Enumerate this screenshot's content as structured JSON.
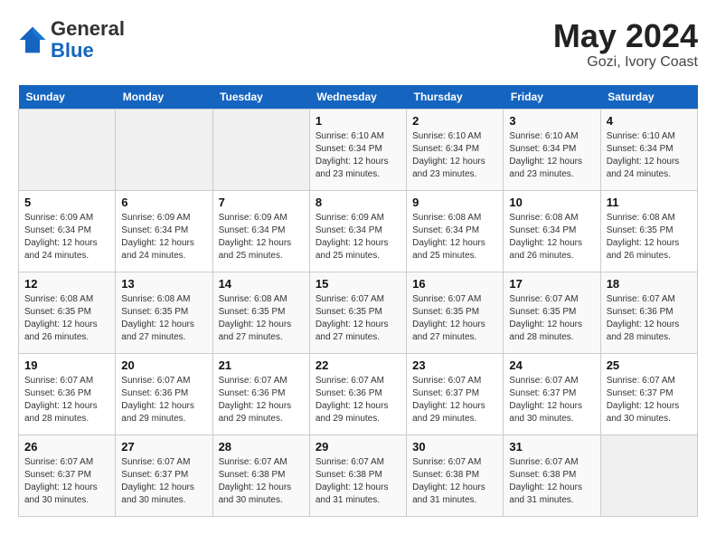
{
  "header": {
    "logo_general": "General",
    "logo_blue": "Blue",
    "month_year": "May 2024",
    "location": "Gozi, Ivory Coast"
  },
  "weekdays": [
    "Sunday",
    "Monday",
    "Tuesday",
    "Wednesday",
    "Thursday",
    "Friday",
    "Saturday"
  ],
  "weeks": [
    [
      {
        "day": "",
        "info": ""
      },
      {
        "day": "",
        "info": ""
      },
      {
        "day": "",
        "info": ""
      },
      {
        "day": "1",
        "info": "Sunrise: 6:10 AM\nSunset: 6:34 PM\nDaylight: 12 hours\nand 23 minutes."
      },
      {
        "day": "2",
        "info": "Sunrise: 6:10 AM\nSunset: 6:34 PM\nDaylight: 12 hours\nand 23 minutes."
      },
      {
        "day": "3",
        "info": "Sunrise: 6:10 AM\nSunset: 6:34 PM\nDaylight: 12 hours\nand 23 minutes."
      },
      {
        "day": "4",
        "info": "Sunrise: 6:10 AM\nSunset: 6:34 PM\nDaylight: 12 hours\nand 24 minutes."
      }
    ],
    [
      {
        "day": "5",
        "info": "Sunrise: 6:09 AM\nSunset: 6:34 PM\nDaylight: 12 hours\nand 24 minutes."
      },
      {
        "day": "6",
        "info": "Sunrise: 6:09 AM\nSunset: 6:34 PM\nDaylight: 12 hours\nand 24 minutes."
      },
      {
        "day": "7",
        "info": "Sunrise: 6:09 AM\nSunset: 6:34 PM\nDaylight: 12 hours\nand 25 minutes."
      },
      {
        "day": "8",
        "info": "Sunrise: 6:09 AM\nSunset: 6:34 PM\nDaylight: 12 hours\nand 25 minutes."
      },
      {
        "day": "9",
        "info": "Sunrise: 6:08 AM\nSunset: 6:34 PM\nDaylight: 12 hours\nand 25 minutes."
      },
      {
        "day": "10",
        "info": "Sunrise: 6:08 AM\nSunset: 6:34 PM\nDaylight: 12 hours\nand 26 minutes."
      },
      {
        "day": "11",
        "info": "Sunrise: 6:08 AM\nSunset: 6:35 PM\nDaylight: 12 hours\nand 26 minutes."
      }
    ],
    [
      {
        "day": "12",
        "info": "Sunrise: 6:08 AM\nSunset: 6:35 PM\nDaylight: 12 hours\nand 26 minutes."
      },
      {
        "day": "13",
        "info": "Sunrise: 6:08 AM\nSunset: 6:35 PM\nDaylight: 12 hours\nand 27 minutes."
      },
      {
        "day": "14",
        "info": "Sunrise: 6:08 AM\nSunset: 6:35 PM\nDaylight: 12 hours\nand 27 minutes."
      },
      {
        "day": "15",
        "info": "Sunrise: 6:07 AM\nSunset: 6:35 PM\nDaylight: 12 hours\nand 27 minutes."
      },
      {
        "day": "16",
        "info": "Sunrise: 6:07 AM\nSunset: 6:35 PM\nDaylight: 12 hours\nand 27 minutes."
      },
      {
        "day": "17",
        "info": "Sunrise: 6:07 AM\nSunset: 6:35 PM\nDaylight: 12 hours\nand 28 minutes."
      },
      {
        "day": "18",
        "info": "Sunrise: 6:07 AM\nSunset: 6:36 PM\nDaylight: 12 hours\nand 28 minutes."
      }
    ],
    [
      {
        "day": "19",
        "info": "Sunrise: 6:07 AM\nSunset: 6:36 PM\nDaylight: 12 hours\nand 28 minutes."
      },
      {
        "day": "20",
        "info": "Sunrise: 6:07 AM\nSunset: 6:36 PM\nDaylight: 12 hours\nand 29 minutes."
      },
      {
        "day": "21",
        "info": "Sunrise: 6:07 AM\nSunset: 6:36 PM\nDaylight: 12 hours\nand 29 minutes."
      },
      {
        "day": "22",
        "info": "Sunrise: 6:07 AM\nSunset: 6:36 PM\nDaylight: 12 hours\nand 29 minutes."
      },
      {
        "day": "23",
        "info": "Sunrise: 6:07 AM\nSunset: 6:37 PM\nDaylight: 12 hours\nand 29 minutes."
      },
      {
        "day": "24",
        "info": "Sunrise: 6:07 AM\nSunset: 6:37 PM\nDaylight: 12 hours\nand 30 minutes."
      },
      {
        "day": "25",
        "info": "Sunrise: 6:07 AM\nSunset: 6:37 PM\nDaylight: 12 hours\nand 30 minutes."
      }
    ],
    [
      {
        "day": "26",
        "info": "Sunrise: 6:07 AM\nSunset: 6:37 PM\nDaylight: 12 hours\nand 30 minutes."
      },
      {
        "day": "27",
        "info": "Sunrise: 6:07 AM\nSunset: 6:37 PM\nDaylight: 12 hours\nand 30 minutes."
      },
      {
        "day": "28",
        "info": "Sunrise: 6:07 AM\nSunset: 6:38 PM\nDaylight: 12 hours\nand 30 minutes."
      },
      {
        "day": "29",
        "info": "Sunrise: 6:07 AM\nSunset: 6:38 PM\nDaylight: 12 hours\nand 31 minutes."
      },
      {
        "day": "30",
        "info": "Sunrise: 6:07 AM\nSunset: 6:38 PM\nDaylight: 12 hours\nand 31 minutes."
      },
      {
        "day": "31",
        "info": "Sunrise: 6:07 AM\nSunset: 6:38 PM\nDaylight: 12 hours\nand 31 minutes."
      },
      {
        "day": "",
        "info": ""
      }
    ]
  ]
}
